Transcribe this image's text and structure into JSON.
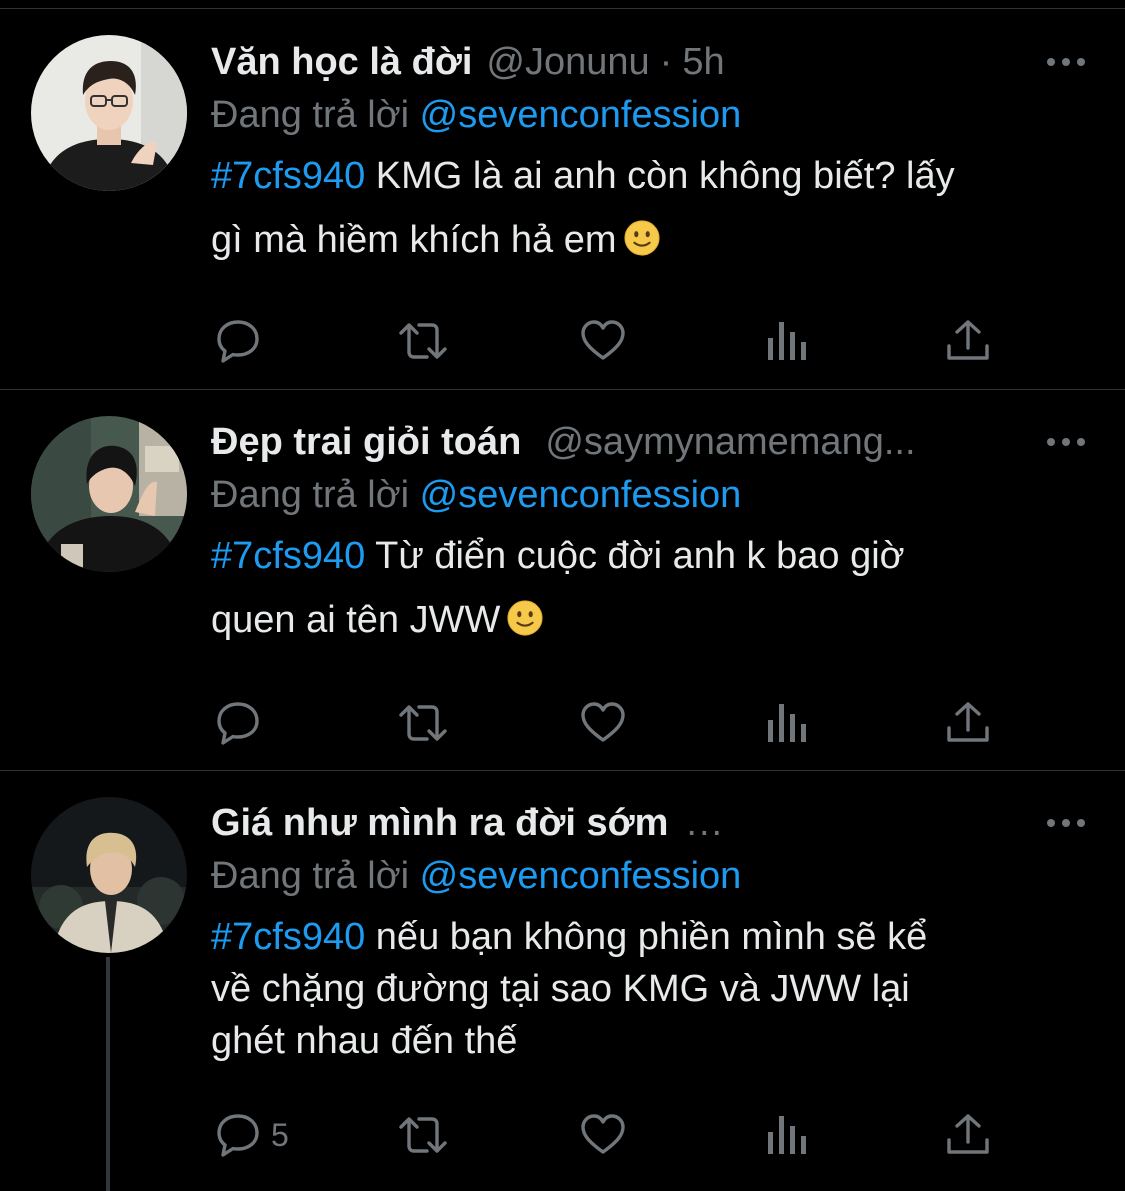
{
  "tweets": [
    {
      "name": "Văn học là đời",
      "handle": "@Jonunu",
      "dot": "·",
      "time": "5h",
      "replying_label": "Đang trả lời",
      "replying_to": "@sevenconfession",
      "hashtag": "#7cfs940",
      "text_lines": [
        "KMG là ai anh còn không biết? lấy",
        "gì mà hiềm khích hả em"
      ],
      "reply_count": ""
    },
    {
      "name": "Đẹp trai giỏi toán",
      "handle": "@saymynamemang...",
      "replying_label": "Đang trả lời",
      "replying_to": "@sevenconfession",
      "hashtag": "#7cfs940",
      "text_lines": [
        "Từ điển cuộc đời anh k bao giờ",
        "quen ai tên JWW"
      ],
      "reply_count": ""
    },
    {
      "name": "Giá như mình ra đời sớm",
      "handle_ellipsis": "...",
      "replying_label": "Đang trả lời",
      "replying_to": "@sevenconfession",
      "hashtag": "#7cfs940",
      "text_lines": [
        "nếu bạn không phiền mình sẽ kể",
        "về chặng đường tại sao KMG và JWW lại",
        "ghét nhau đến thế"
      ],
      "reply_count": "5"
    }
  ],
  "icons": {
    "more": "more-horizontal-icon",
    "reply": "reply-bubble-icon",
    "retweet": "retweet-icon",
    "like": "heart-icon",
    "views": "analytics-bars-icon",
    "share": "share-upload-icon"
  },
  "colors": {
    "background": "#000000",
    "text": "#e7e9ea",
    "secondary": "#71767b",
    "accent": "#1d9bf0",
    "divider": "#2f3336"
  }
}
